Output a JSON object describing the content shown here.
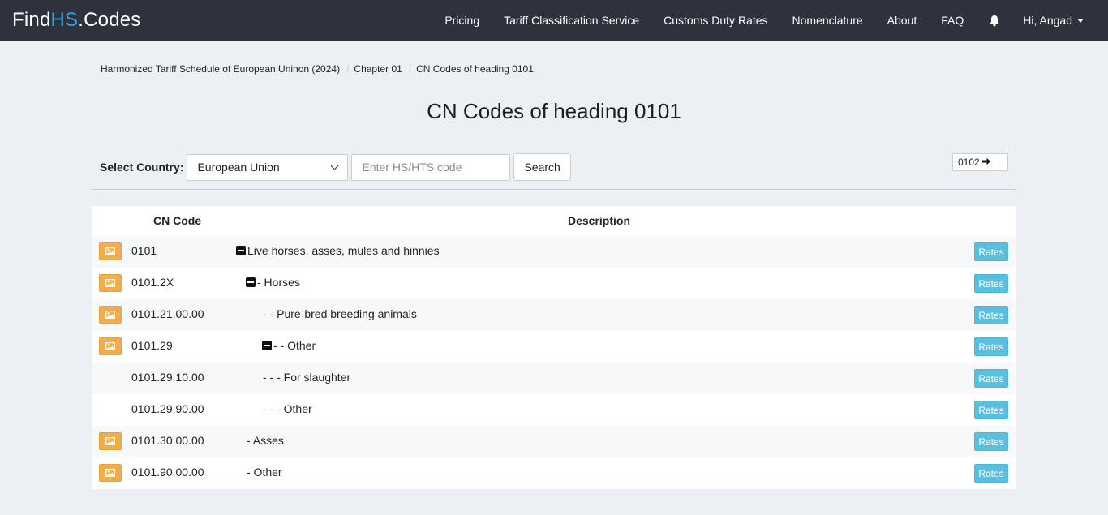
{
  "brand": {
    "part1": "Find",
    "part2": "HS",
    "part3": ".Codes"
  },
  "nav": {
    "items": [
      "Pricing",
      "Tariff Classification Service",
      "Customs Duty Rates",
      "Nomenclature",
      "About",
      "FAQ"
    ],
    "user": "Hi, Angad"
  },
  "breadcrumb": [
    "Harmonized Tariff Schedule of European Uninon (2024)",
    "Chapter 01",
    "CN Codes of heading 0101"
  ],
  "page": {
    "title": "CN Codes of heading 0101"
  },
  "search": {
    "label": "Select Country:",
    "country": "European Union",
    "placeholder": "Enter HS/HTS code",
    "button": "Search",
    "next_code": "0102"
  },
  "table": {
    "headers": {
      "code": "CN Code",
      "description": "Description"
    },
    "rates_label": "Rates",
    "rows": [
      {
        "code": "0101",
        "description": "Live horses, asses, mules and hinnies",
        "has_image": true,
        "toggle": true,
        "indent": 0
      },
      {
        "code": "0101.2X",
        "description": "- Horses",
        "has_image": true,
        "toggle": true,
        "indent": 1
      },
      {
        "code": "0101.21.00.00",
        "description": "- - Pure-bred breeding animals",
        "has_image": true,
        "toggle": false,
        "indent": 2
      },
      {
        "code": "0101.29",
        "description": "- - Other",
        "has_image": true,
        "toggle": true,
        "indent": 2
      },
      {
        "code": "0101.29.10.00",
        "description": "- - - For slaughter",
        "has_image": false,
        "toggle": false,
        "indent": 3
      },
      {
        "code": "0101.29.90.00",
        "description": "- - - Other",
        "has_image": false,
        "toggle": false,
        "indent": 3
      },
      {
        "code": "0101.30.00.00",
        "description": "- Asses",
        "has_image": true,
        "toggle": false,
        "indent": 1
      },
      {
        "code": "0101.90.00.00",
        "description": "- Other",
        "has_image": true,
        "toggle": false,
        "indent": 1
      }
    ]
  }
}
